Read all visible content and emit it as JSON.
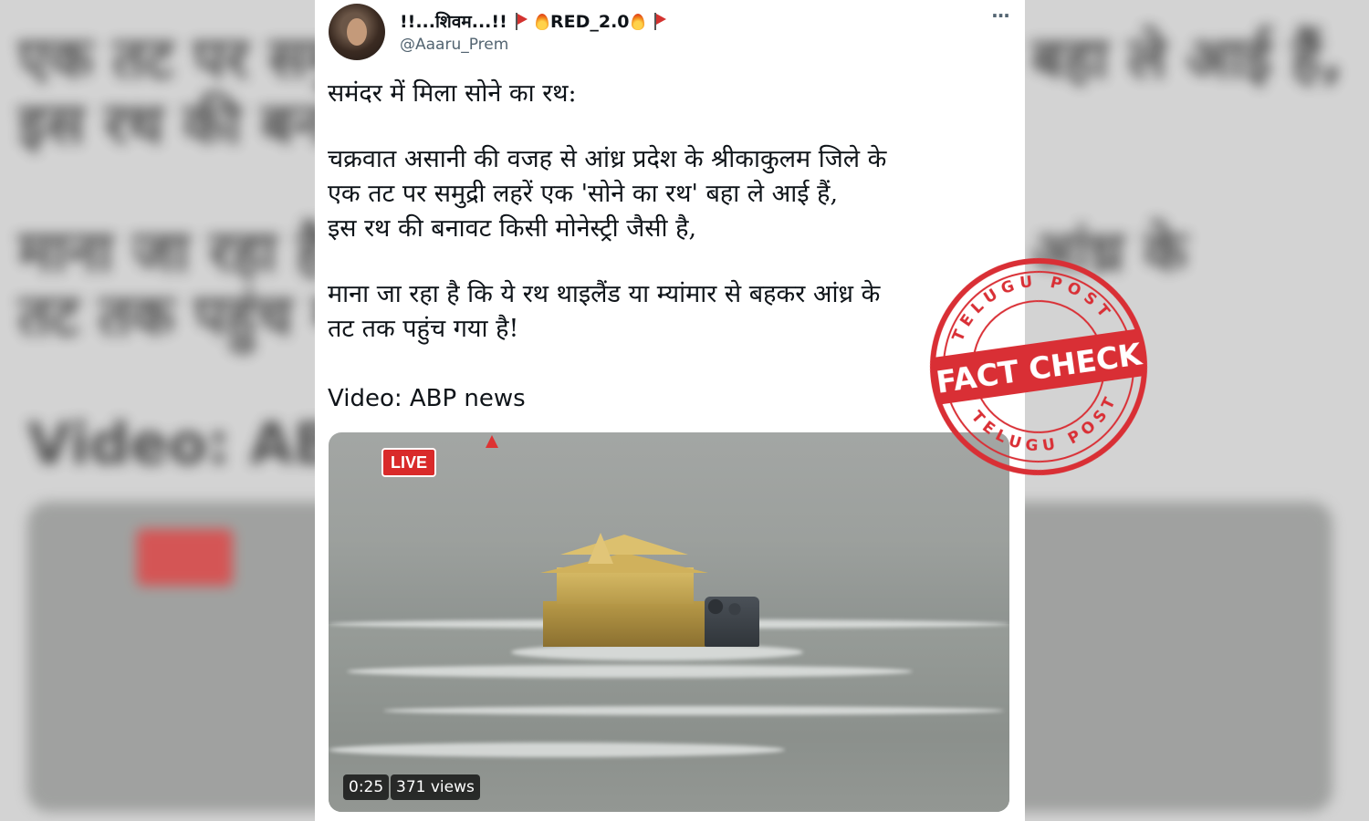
{
  "tweet": {
    "display_name_prefix": "!!...शिवम...!!",
    "display_name_tag": "RED_2.0",
    "handle": "@Aaaru_Prem",
    "lines": [
      "समंदर में मिला सोने का रथ:",
      "चक्रवात असानी की वजह से आंध्र प्रदेश के श्रीकाकुलम जिले के",
      "एक तट पर समुद्री लहरें एक 'सोने का रथ' बहा ले आई हैं,",
      "इस रथ की बनावट किसी मोनेस्ट्री जैसी है,",
      "माना जा रहा है कि ये रथ थाइलैंड या म्यांमार से बहकर आंध्र के",
      "तट तक पहुंच गया है!"
    ],
    "video_credit": "Video: ABP news"
  },
  "video": {
    "live_label": "LIVE",
    "duration": "0:25",
    "views": "371 views"
  },
  "stamp": {
    "top_arc": "TELUGU POST",
    "center": "FACT CHECK",
    "bottom_arc": "TELUGU POST",
    "color": "#d92f35"
  },
  "icons": {
    "more": "more-options-icon",
    "flag": "red-flag-icon",
    "fire": "fire-icon"
  }
}
